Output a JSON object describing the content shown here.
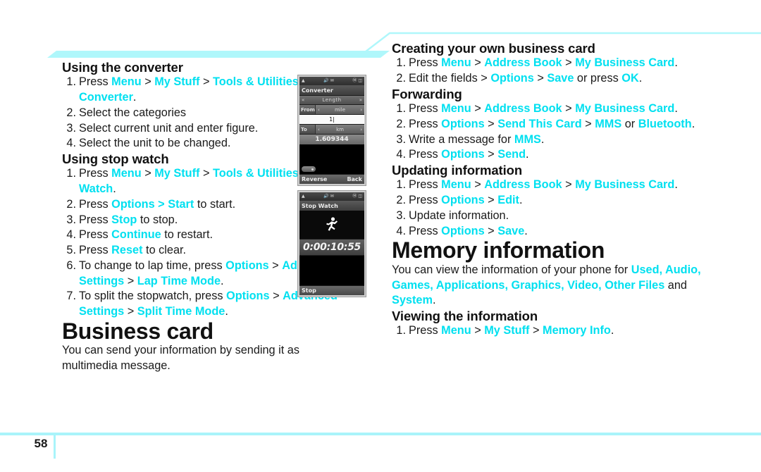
{
  "document": {
    "page_number": "58",
    "accent_color": "#00e0f0",
    "band_color": "#aff7fb",
    "rule_color": "#a9f4fa"
  },
  "left_column": {
    "section_converter": {
      "heading": "Using the converter",
      "steps": [
        {
          "num": "1.",
          "parts": [
            {
              "t": "Press ",
              "hl": false
            },
            {
              "t": "Menu",
              "hl": true
            },
            {
              "t": " > ",
              "hl": false
            },
            {
              "t": "My Stuff",
              "hl": true
            },
            {
              "t": " > ",
              "hl": false
            },
            {
              "t": "Tools & Utilities",
              "hl": true
            },
            {
              "t": " > ",
              "hl": false
            },
            {
              "t": "Converter",
              "hl": true
            },
            {
              "t": ".",
              "hl": false
            }
          ]
        },
        {
          "num": "2.",
          "parts": [
            {
              "t": "Select the categories",
              "hl": false
            }
          ]
        },
        {
          "num": "3.",
          "parts": [
            {
              "t": "Select current unit and enter figure.",
              "hl": false
            }
          ]
        },
        {
          "num": "4.",
          "parts": [
            {
              "t": "Select the unit to be changed.",
              "hl": false
            }
          ]
        }
      ]
    },
    "section_stopwatch": {
      "heading": "Using stop watch",
      "steps": [
        {
          "num": "1.",
          "parts": [
            {
              "t": "Press ",
              "hl": false
            },
            {
              "t": "Menu",
              "hl": true
            },
            {
              "t": " > ",
              "hl": false
            },
            {
              "t": "My Stuff",
              "hl": true
            },
            {
              "t": " > ",
              "hl": false
            },
            {
              "t": "Tools & Utilities",
              "hl": true
            },
            {
              "t": " > ",
              "hl": false
            },
            {
              "t": "Stop Watch",
              "hl": true
            },
            {
              "t": ".",
              "hl": false
            }
          ]
        },
        {
          "num": "2.",
          "parts": [
            {
              "t": "Press ",
              "hl": false
            },
            {
              "t": "Options > Start",
              "hl": true
            },
            {
              "t": " to start.",
              "hl": false
            }
          ]
        },
        {
          "num": "3.",
          "parts": [
            {
              "t": "Press ",
              "hl": false
            },
            {
              "t": "Stop",
              "hl": true
            },
            {
              "t": " to stop.",
              "hl": false
            }
          ]
        },
        {
          "num": "4.",
          "parts": [
            {
              "t": "Press ",
              "hl": false
            },
            {
              "t": "Continue",
              "hl": true
            },
            {
              "t": " to restart.",
              "hl": false
            }
          ]
        },
        {
          "num": "5.",
          "parts": [
            {
              "t": "Press ",
              "hl": false
            },
            {
              "t": "Reset",
              "hl": true
            },
            {
              "t": " to clear.",
              "hl": false
            }
          ]
        },
        {
          "num": "6.",
          "parts": [
            {
              "t": "To change to lap time, press ",
              "hl": false
            },
            {
              "t": "Options",
              "hl": true
            },
            {
              "t": " > ",
              "hl": false
            },
            {
              "t": "Advanced Settings",
              "hl": true
            },
            {
              "t": " > ",
              "hl": false
            },
            {
              "t": "Lap Time Mode",
              "hl": true
            },
            {
              "t": ".",
              "hl": false
            }
          ]
        },
        {
          "num": "7.",
          "parts": [
            {
              "t": "To split the stopwatch, press ",
              "hl": false
            },
            {
              "t": "Options",
              "hl": true
            },
            {
              "t": " > ",
              "hl": false
            },
            {
              "t": "Advanced Settings",
              "hl": true
            },
            {
              "t": " > ",
              "hl": false
            },
            {
              "t": "Split Time Mode",
              "hl": true
            },
            {
              "t": ".",
              "hl": false
            }
          ]
        }
      ]
    },
    "section_business_card": {
      "heading": "Business card",
      "body": "You can send your information by sending it as multimedia message."
    }
  },
  "right_column": {
    "section_creating": {
      "heading": "Creating your own business card",
      "steps": [
        {
          "num": "1.",
          "parts": [
            {
              "t": "Press ",
              "hl": false
            },
            {
              "t": "Menu",
              "hl": true
            },
            {
              "t": " > ",
              "hl": false
            },
            {
              "t": "Address Book",
              "hl": true
            },
            {
              "t": " > ",
              "hl": false
            },
            {
              "t": "My Business Card",
              "hl": true
            },
            {
              "t": ".",
              "hl": false
            }
          ]
        },
        {
          "num": "2.",
          "parts": [
            {
              "t": "Edit the fields > ",
              "hl": false
            },
            {
              "t": "Options",
              "hl": true
            },
            {
              "t": " > ",
              "hl": false
            },
            {
              "t": "Save",
              "hl": true
            },
            {
              "t": " or press ",
              "hl": false
            },
            {
              "t": "OK",
              "hl": true
            },
            {
              "t": ".",
              "hl": false
            }
          ]
        }
      ]
    },
    "section_forwarding": {
      "heading": "Forwarding",
      "steps": [
        {
          "num": "1.",
          "parts": [
            {
              "t": "Press ",
              "hl": false
            },
            {
              "t": "Menu",
              "hl": true
            },
            {
              "t": " > ",
              "hl": false
            },
            {
              "t": "Address Book",
              "hl": true
            },
            {
              "t": " > ",
              "hl": false
            },
            {
              "t": "My Business Card",
              "hl": true
            },
            {
              "t": ".",
              "hl": false
            }
          ]
        },
        {
          "num": "2.",
          "parts": [
            {
              "t": "Press ",
              "hl": false
            },
            {
              "t": "Options",
              "hl": true
            },
            {
              "t": " > ",
              "hl": false
            },
            {
              "t": "Send This Card",
              "hl": true
            },
            {
              "t": " > ",
              "hl": false
            },
            {
              "t": "MMS",
              "hl": true
            },
            {
              "t": " or ",
              "hl": false
            },
            {
              "t": "Bluetooth",
              "hl": true
            },
            {
              "t": ".",
              "hl": false
            }
          ]
        },
        {
          "num": "3.",
          "parts": [
            {
              "t": "Write a message for ",
              "hl": false
            },
            {
              "t": "MMS",
              "hl": true
            },
            {
              "t": ".",
              "hl": false
            }
          ]
        },
        {
          "num": "4.",
          "parts": [
            {
              "t": "Press ",
              "hl": false
            },
            {
              "t": "Options",
              "hl": true
            },
            {
              "t": " > ",
              "hl": false
            },
            {
              "t": "Send",
              "hl": true
            },
            {
              "t": ".",
              "hl": false
            }
          ]
        }
      ]
    },
    "section_updating": {
      "heading": "Updating information",
      "steps": [
        {
          "num": "1.",
          "parts": [
            {
              "t": "Press ",
              "hl": false
            },
            {
              "t": "Menu",
              "hl": true
            },
            {
              "t": " > ",
              "hl": false
            },
            {
              "t": "Address Book",
              "hl": true
            },
            {
              "t": " > ",
              "hl": false
            },
            {
              "t": "My Business Card",
              "hl": true
            },
            {
              "t": ".",
              "hl": false
            }
          ]
        },
        {
          "num": "2.",
          "parts": [
            {
              "t": "Press ",
              "hl": false
            },
            {
              "t": "Options",
              "hl": true
            },
            {
              "t": " > ",
              "hl": false
            },
            {
              "t": "Edit",
              "hl": true
            },
            {
              "t": ".",
              "hl": false
            }
          ]
        },
        {
          "num": "3.",
          "parts": [
            {
              "t": "Update information.",
              "hl": false
            }
          ]
        },
        {
          "num": "4.",
          "parts": [
            {
              "t": "Press ",
              "hl": false
            },
            {
              "t": "Options",
              "hl": true
            },
            {
              "t": " > ",
              "hl": false
            },
            {
              "t": "Save",
              "hl": true
            },
            {
              "t": ".",
              "hl": false
            }
          ]
        }
      ]
    },
    "section_memory": {
      "heading": "Memory information",
      "body_parts": [
        {
          "t": "You can view the information of your phone for ",
          "hl": false
        },
        {
          "t": "Used, Audio, Games, Applications, Graphics, Video, Other Files",
          "hl": true
        },
        {
          "t": " and ",
          "hl": false
        },
        {
          "t": "System",
          "hl": true
        },
        {
          "t": ".",
          "hl": false
        }
      ]
    },
    "section_viewing": {
      "heading": "Viewing the information",
      "steps": [
        {
          "num": "1.",
          "parts": [
            {
              "t": "Press ",
              "hl": false
            },
            {
              "t": "Menu",
              "hl": true
            },
            {
              "t": " > ",
              "hl": false
            },
            {
              "t": "My Stuff",
              "hl": true
            },
            {
              "t": " > ",
              "hl": false
            },
            {
              "t": "Memory Info",
              "hl": true
            },
            {
              "t": ".",
              "hl": false
            }
          ]
        }
      ]
    }
  },
  "phone_converter": {
    "status_signal": "signal-icon",
    "status_speaker": "speaker-icon",
    "status_message": "envelope-icon",
    "status_bluetooth": "bluetooth-icon",
    "status_battery": "battery-icon",
    "title": "Converter",
    "category_left_arrow": "«",
    "category": "Length",
    "category_right_arrow": "»",
    "from_label": "From",
    "from_left_arrow": "‹",
    "from_unit": "mile",
    "from_right_arrow": "›",
    "input_value": "1|",
    "to_label": "To",
    "to_left_arrow": "‹",
    "to_unit": "km",
    "to_right_arrow": "›",
    "result": "1.609344",
    "softkey_left": "Reverse",
    "softkey_right": "Back"
  },
  "phone_stopwatch": {
    "title": "Stop Watch",
    "runner_icon": "runner-icon",
    "time": "0:00:10:55",
    "softkey_left": "Stop"
  }
}
